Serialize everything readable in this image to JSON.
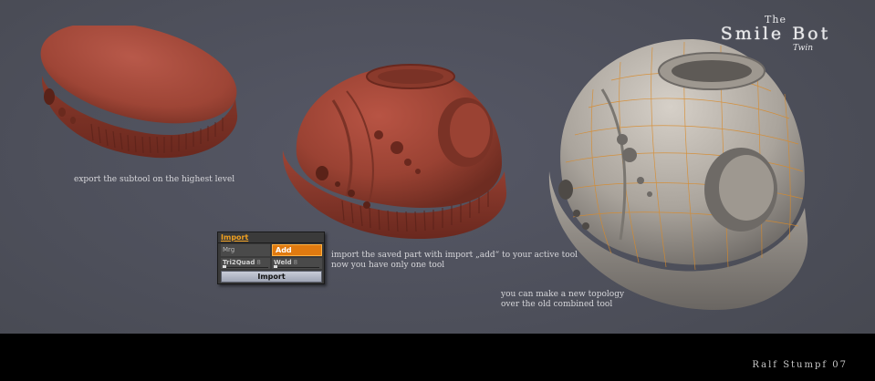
{
  "title": {
    "the": "The",
    "main": "Smile Bot",
    "sub": "Twin"
  },
  "captions": {
    "export": "export the subtool on the highest level",
    "import_line1": "import the saved part with import „add“ to your active tool",
    "import_line2": "now you have only one tool",
    "topology_line1": "you can make a new topology",
    "topology_line2": "over the old combined tool"
  },
  "import_panel": {
    "title": "Import",
    "mrg_label": "Mrg",
    "add_label": "Add",
    "tri2quad_label": "Tri2Quad",
    "tri2quad_value": "8",
    "weld_label": "Weld",
    "weld_value": "8",
    "import_button": "Import"
  },
  "credit": "Ralf Stumpf 07",
  "colors": {
    "background": "#4d4f5a",
    "clay": "#a4493a",
    "mesh_gray": "#b8b3ad",
    "wire_orange": "#d88a2a",
    "accent": "#e07a10"
  }
}
